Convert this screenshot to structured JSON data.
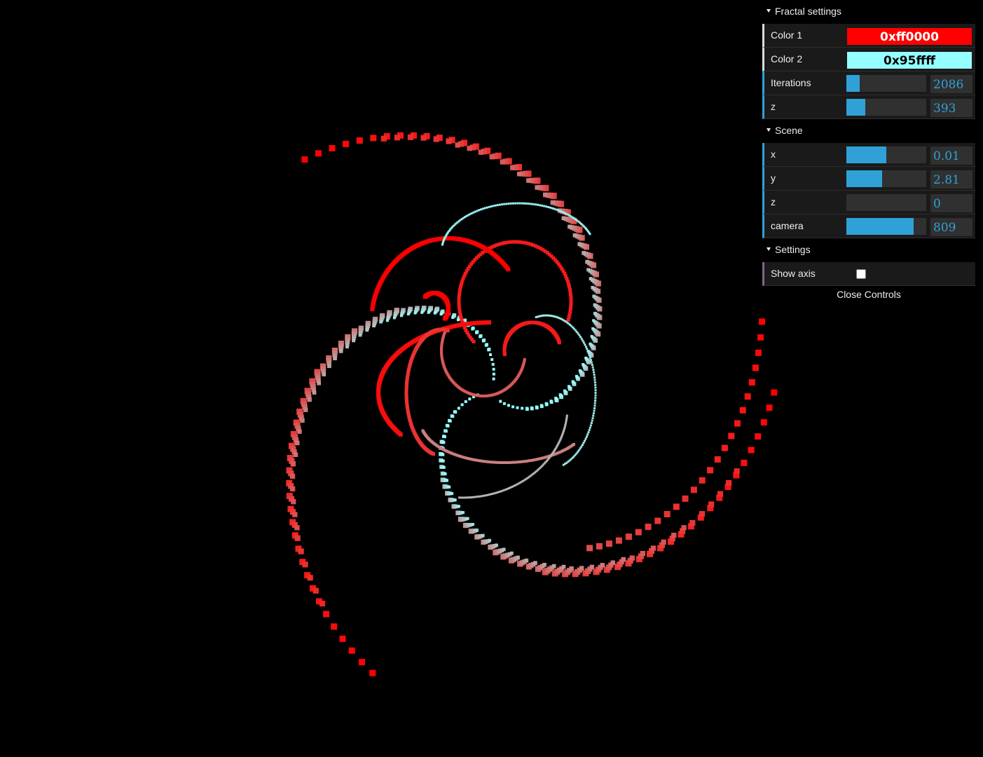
{
  "gui": {
    "folders": [
      {
        "title": "Fractal settings",
        "rows": [
          {
            "type": "color",
            "label": "Color 1",
            "value": "0xff0000",
            "bg": "#ff0000",
            "fg": "#ffffff"
          },
          {
            "type": "color",
            "label": "Color 2",
            "value": "0x95ffff",
            "bg": "#95ffff",
            "fg": "#000000"
          },
          {
            "type": "number",
            "label": "Iterations",
            "value": "2086",
            "fill": 0.17
          },
          {
            "type": "number",
            "label": "z",
            "value": "393",
            "fill": 0.24
          }
        ]
      },
      {
        "title": "Scene",
        "rows": [
          {
            "type": "number",
            "label": "x",
            "value": "0.01",
            "fill": 0.5
          },
          {
            "type": "number",
            "label": "y",
            "value": "2.81",
            "fill": 0.45
          },
          {
            "type": "number",
            "label": "z",
            "value": "0",
            "fill": 0.0
          },
          {
            "type": "number",
            "label": "camera",
            "value": "809",
            "fill": 0.84
          }
        ]
      },
      {
        "title": "Settings",
        "rows": [
          {
            "type": "boolean",
            "label": "Show axis",
            "checked": false
          }
        ]
      }
    ],
    "close_label": "Close Controls"
  },
  "fractal": {
    "color1": "#ff0000",
    "color2": "#95ffff",
    "background": "#000000"
  }
}
